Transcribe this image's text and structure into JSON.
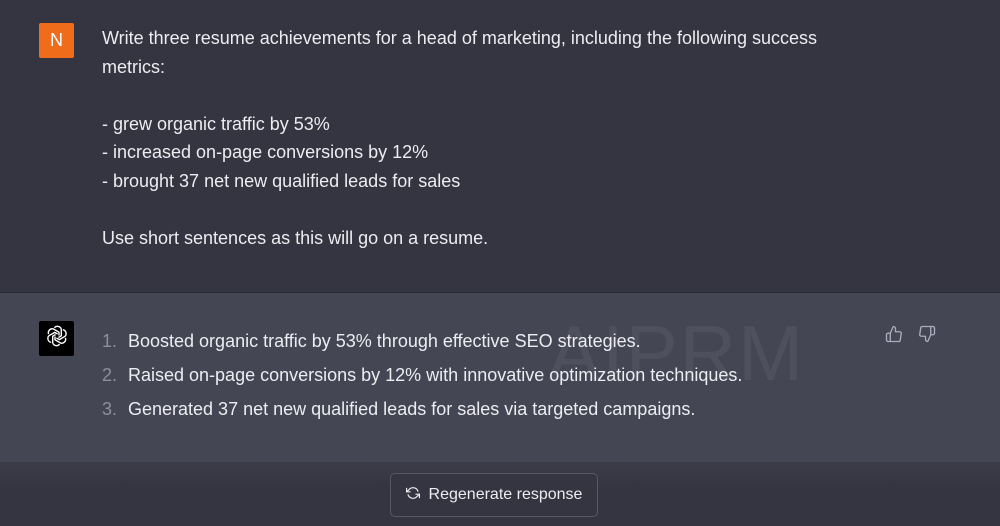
{
  "user_message": {
    "avatar_initial": "N",
    "avatar_color": "#ef6c1a",
    "lines": [
      "Write three resume achievements for a head of marketing, including the following success",
      "metrics:",
      "",
      "- grew organic traffic by 53%",
      "- increased on-page conversions by 12%",
      "- brought 37 net new qualified leads for sales",
      "",
      "Use short sentences as this will go on a resume."
    ]
  },
  "assistant_message": {
    "avatar_icon": "openai-logo-icon",
    "watermark": "AIPRM",
    "items": [
      {
        "number": "1.",
        "text": "Boosted organic traffic by 53% through effective SEO strategies."
      },
      {
        "number": "2.",
        "text": "Raised on-page conversions by 12% with innovative optimization techniques."
      },
      {
        "number": "3.",
        "text": "Generated 37 net new qualified leads for sales via targeted campaigns."
      }
    ],
    "feedback_icons": [
      "thumbs-up-icon",
      "thumbs-down-icon"
    ]
  },
  "footer": {
    "regenerate_icon": "refresh-icon",
    "regenerate_label": "Regenerate response"
  },
  "colors": {
    "background": "#343541",
    "assistant_background": "#444654",
    "text": "#ececf1",
    "muted_text": "#8e8ea0"
  }
}
